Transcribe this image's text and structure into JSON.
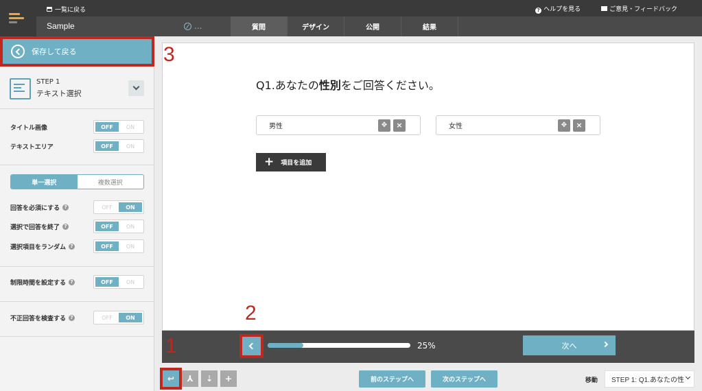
{
  "header": {
    "back_to_list": "一覧に戻る",
    "app_title": "Sample",
    "edit_indicator": "...",
    "tabs": [
      "質問",
      "デザイン",
      "公開",
      "結果"
    ],
    "help": "ヘルプを見る",
    "feedback": "ご意見・フィードバック"
  },
  "sidebar": {
    "save_back": "保存して戻る",
    "step_num": "STEP 1",
    "step_name": "テキスト選択",
    "options": [
      {
        "label": "タイトル画像",
        "off": "OFF",
        "on": "ON",
        "state": "OFF"
      },
      {
        "label": "テキストエリア",
        "off": "OFF",
        "on": "ON",
        "state": "OFF"
      }
    ],
    "select_mode": {
      "single": "単一選択",
      "multi": "複数選択",
      "selected": "単一選択"
    },
    "answer_opts": [
      {
        "label": "回答を必須にする",
        "off": "OFF",
        "on": "ON",
        "state": "ON"
      },
      {
        "label": "選択で回答を終了",
        "off": "OFF",
        "on": "ON",
        "state": "OFF"
      },
      {
        "label": "選択項目をランダム",
        "off": "OFF",
        "on": "ON",
        "state": "OFF"
      }
    ],
    "time_limit": {
      "label": "制限時間を設定する",
      "off": "OFF",
      "on": "ON",
      "state": "OFF"
    },
    "fraud_check": {
      "label": "不正回答を検査する",
      "off": "OFF",
      "on": "ON",
      "state": "ON"
    }
  },
  "main": {
    "question_prefix": "Q1.あなたの",
    "question_bold": "性別",
    "question_suffix": "をご回答ください。",
    "choices": [
      "男性",
      "女性"
    ],
    "add_item": "項目を追加",
    "progress_percent_text": "25%",
    "progress_fraction": 0.25,
    "next_label": "次へ"
  },
  "annotations": {
    "one": "1",
    "two": "2",
    "three": "3"
  },
  "bottom": {
    "prev_step": "前のステップへ",
    "next_step": "次のステップへ",
    "move_label": "移動",
    "move_value": "STEP 1: Q1.あなたの性"
  },
  "colors": {
    "accent": "#6fb0c4",
    "annotation": "#c0281f",
    "dark": "#3a3a3a"
  }
}
